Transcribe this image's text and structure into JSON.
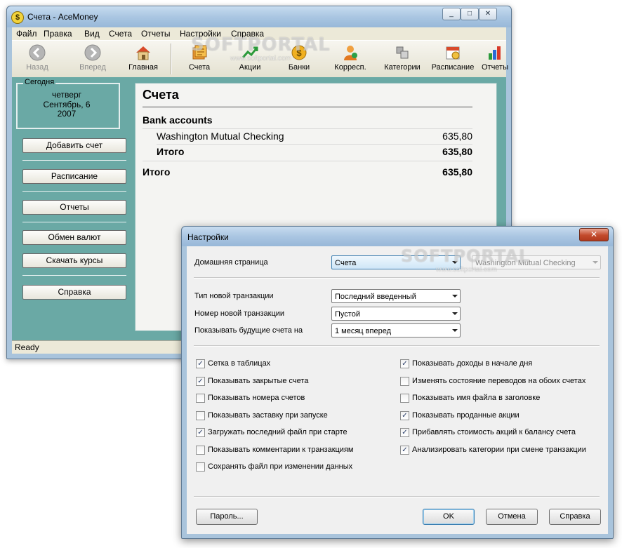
{
  "main_window": {
    "title": "Счета - AceMoney",
    "caption_buttons": [
      "_",
      "□",
      "✕"
    ]
  },
  "menu": [
    "Файл",
    "Правка",
    "Вид",
    "Счета",
    "Отчеты",
    "Настройки",
    "Справка"
  ],
  "toolbar": [
    {
      "label": "Назад",
      "icon": "back-arrow-icon",
      "disabled": true
    },
    {
      "label": "Вперед",
      "icon": "forward-arrow-icon",
      "disabled": true
    },
    {
      "label": "Главная",
      "icon": "home-icon",
      "disabled": false
    },
    {
      "label": "Счета",
      "icon": "accounts-icon",
      "disabled": false
    },
    {
      "label": "Акции",
      "icon": "stocks-icon",
      "disabled": false
    },
    {
      "label": "Банки",
      "icon": "banks-icon",
      "disabled": false
    },
    {
      "label": "Корресп.",
      "icon": "payees-icon",
      "disabled": false
    },
    {
      "label": "Категории",
      "icon": "categories-icon",
      "disabled": false
    },
    {
      "label": "Расписание",
      "icon": "schedule-icon",
      "disabled": false
    },
    {
      "label": "Отчеты",
      "icon": "reports-icon",
      "disabled": false
    }
  ],
  "sidebar": {
    "today_legend": "Сегодня",
    "weekday": "четверг",
    "date": "Сентябрь, 6",
    "year": "2007",
    "buttons": [
      "Добавить счет",
      "Расписание",
      "Отчеты",
      "Обмен валют",
      "Скачать курсы",
      "Справка"
    ]
  },
  "content": {
    "title": "Счета",
    "group": "Bank accounts",
    "account_name": "Washington Mutual Checking",
    "account_value": "635,80",
    "subtotal_label": "Итого",
    "subtotal_value": "635,80",
    "total_label": "Итого",
    "total_value": "635,80"
  },
  "status": "Ready",
  "watermark": {
    "brand_a": "SOFT",
    "brand_b": "PORTAL",
    "url": "www.softportal.com"
  },
  "dialog": {
    "title": "Настройки",
    "close": "✕",
    "home_page_label": "Домашняя страница",
    "home_page_value": "Счета",
    "home_account_value": "Washington Mutual Checking",
    "new_txn_type_label": "Тип новой транзакции",
    "new_txn_type_value": "Последний введенный",
    "new_txn_number_label": "Номер новой транзакции",
    "new_txn_number_value": "Пустой",
    "future_bills_label": "Показывать будущие счета на",
    "future_bills_value": "1 месяц вперед",
    "checkboxes_left": [
      {
        "label": "Сетка в таблицах",
        "checked": true
      },
      {
        "label": "Показывать закрытые счета",
        "checked": true
      },
      {
        "label": "Показывать номера счетов",
        "checked": false
      },
      {
        "label": "Показывать заставку при запуске",
        "checked": false
      },
      {
        "label": "Загружать последний файл при старте",
        "checked": true
      },
      {
        "label": "Показывать комментарии к транзакциям",
        "checked": false
      },
      {
        "label": "Сохранять файл при изменении данных",
        "checked": false
      }
    ],
    "checkboxes_right": [
      {
        "label": "Показывать доходы в начале дня",
        "checked": true
      },
      {
        "label": "Изменять состояние переводов на обоих счетах",
        "checked": false
      },
      {
        "label": "Показывать имя файла в заголовке",
        "checked": false
      },
      {
        "label": "Показывать проданные акции",
        "checked": true
      },
      {
        "label": "Прибавлять стоимость акций к балансу счета",
        "checked": true
      },
      {
        "label": "Анализировать категории при смене транзакции",
        "checked": true
      }
    ],
    "buttons": {
      "password": "Пароль...",
      "ok": "OK",
      "cancel": "Отмена",
      "help": "Справка"
    }
  }
}
